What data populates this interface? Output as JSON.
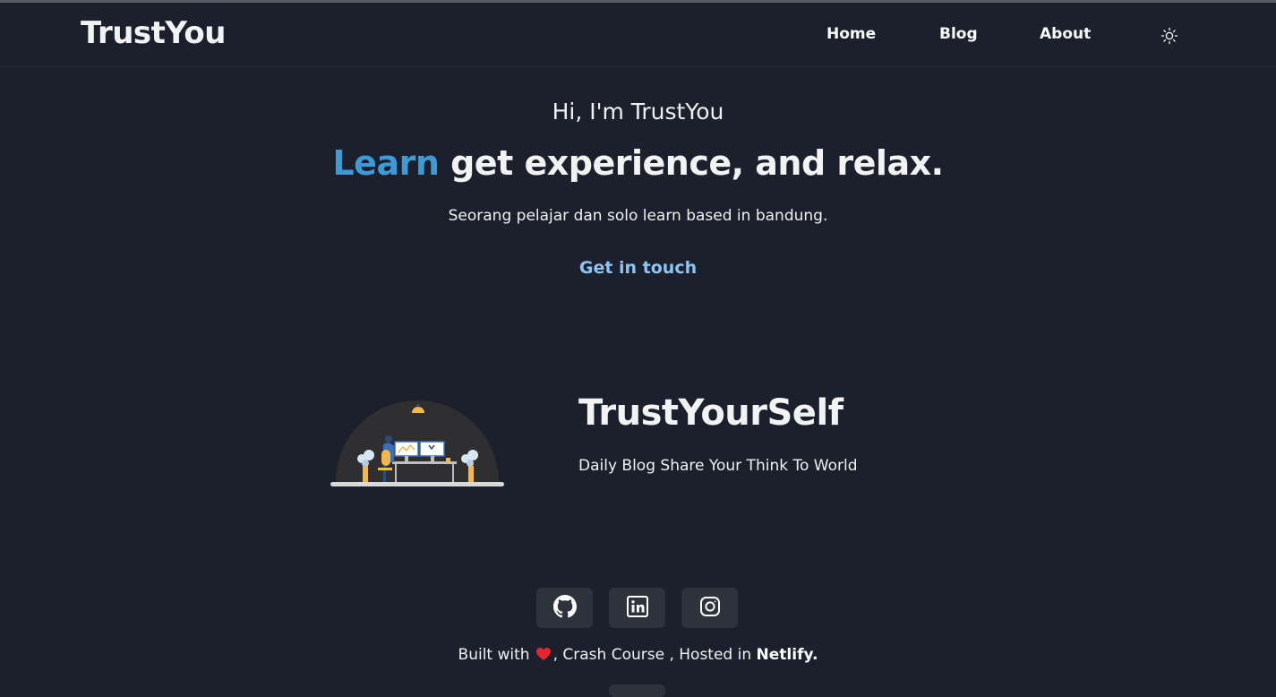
{
  "nav": {
    "brand": "TrustYou",
    "links": [
      "Home",
      "Blog",
      "About"
    ],
    "theme_icon": "sun-icon"
  },
  "hero": {
    "greeting": "Hi, I'm TrustYou",
    "title_accent": "Learn",
    "title_rest": "get experience, and relax.",
    "subtitle": "Seorang pelajar dan solo learn based in bandung.",
    "cta": "Get in touch"
  },
  "about": {
    "title": "TrustYourSelf",
    "subtitle": "Daily Blog Share Your Think To World",
    "illustration": "workspace-illustration"
  },
  "social": [
    "github-icon",
    "linkedin-icon",
    "instagram-icon"
  ],
  "footer": {
    "built_with": "Built with",
    "heart_icon": "heart-icon",
    "middle": ", Crash Course , Hosted in",
    "host": "Netlify."
  },
  "colors": {
    "background": "#1b202c",
    "accent": "#3d9ad7",
    "cta": "#8cc4f4",
    "social_button": "#2d323d"
  }
}
